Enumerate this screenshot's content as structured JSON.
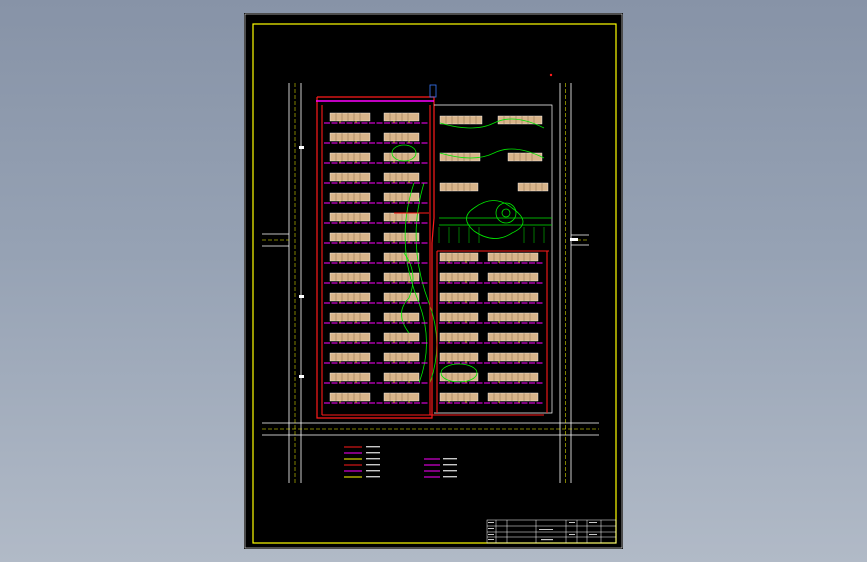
{
  "viewer": {
    "background_top": "#8793a7",
    "background_bottom": "#b1bac7"
  },
  "drawing": {
    "sheet_color": "#000000",
    "frame_color": "#ffff00",
    "colors": {
      "road": "#ffffff",
      "road_centerline": "#ffff00",
      "building": "#d8b48a",
      "main_pipe": "#ff1a1a",
      "branch_pipe": "#ff00ff",
      "service_line": "#ffff00",
      "landscape": "#00e600",
      "water": "#3a7bff"
    },
    "legend_rows": 6,
    "notes_rows": 4
  },
  "title_block": {
    "rows": 4
  }
}
